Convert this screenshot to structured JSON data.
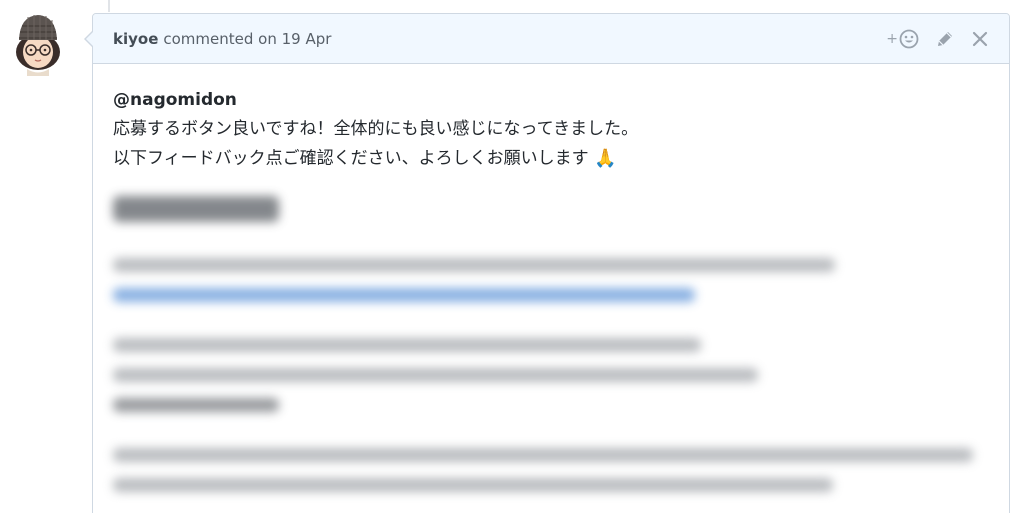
{
  "comment": {
    "author": "kiyoe",
    "action_text": "commented on 19 Apr",
    "mention": "@nagomidon",
    "lines": [
      "応募するボタン良いですね！全体的にも良い感じになってきました。",
      "以下フィードバック点ご確認ください、よろしくお願いします"
    ],
    "closing_emoji": "🙏"
  },
  "header_actions": {
    "reaction_plus": "+",
    "reaction_icon": "smiley-face-icon",
    "edit_icon": "pencil-icon",
    "close_icon": "close-icon"
  },
  "colors": {
    "header_bg": "#f1f8ff",
    "border": "#cfd8e2",
    "icon": "#9aa3ad",
    "text": "#24292e"
  }
}
